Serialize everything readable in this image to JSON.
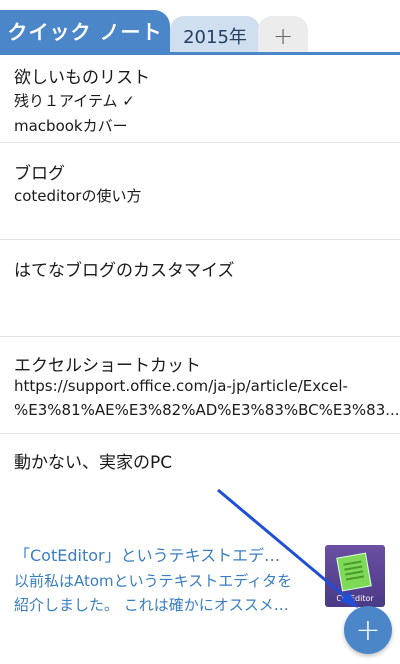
{
  "tabs": {
    "active": "クイック ノート",
    "second": "2015年",
    "add": "+"
  },
  "notes": [
    {
      "title": "欲しいものリスト",
      "line1": "残り１アイテム ✓",
      "line2": "macbookカバー"
    },
    {
      "title": "ブログ",
      "line1": "coteditorの使い方"
    },
    {
      "title": "はてなブログのカスタマイズ"
    },
    {
      "title": "エクセルショートカット",
      "line1": "https://support.office.com/ja-jp/article/Excel-",
      "line2": "%E3%81%AE%E3%82%AD%E3%83%BC%E3%83..."
    },
    {
      "title": "動かない、実家のPC"
    }
  ],
  "preview": {
    "title": "「CotEditor」というテキストエデ…",
    "desc1": "以前私はAtomというテキストエディタを",
    "desc2": "紹介しました。 これは確かにオススメ…",
    "thumb_label": "CotEditor"
  },
  "fab": {
    "label": "+"
  },
  "colors": {
    "accent": "#4a86c8",
    "link": "#3a7ec2",
    "arrow": "#1f4fd6"
  }
}
